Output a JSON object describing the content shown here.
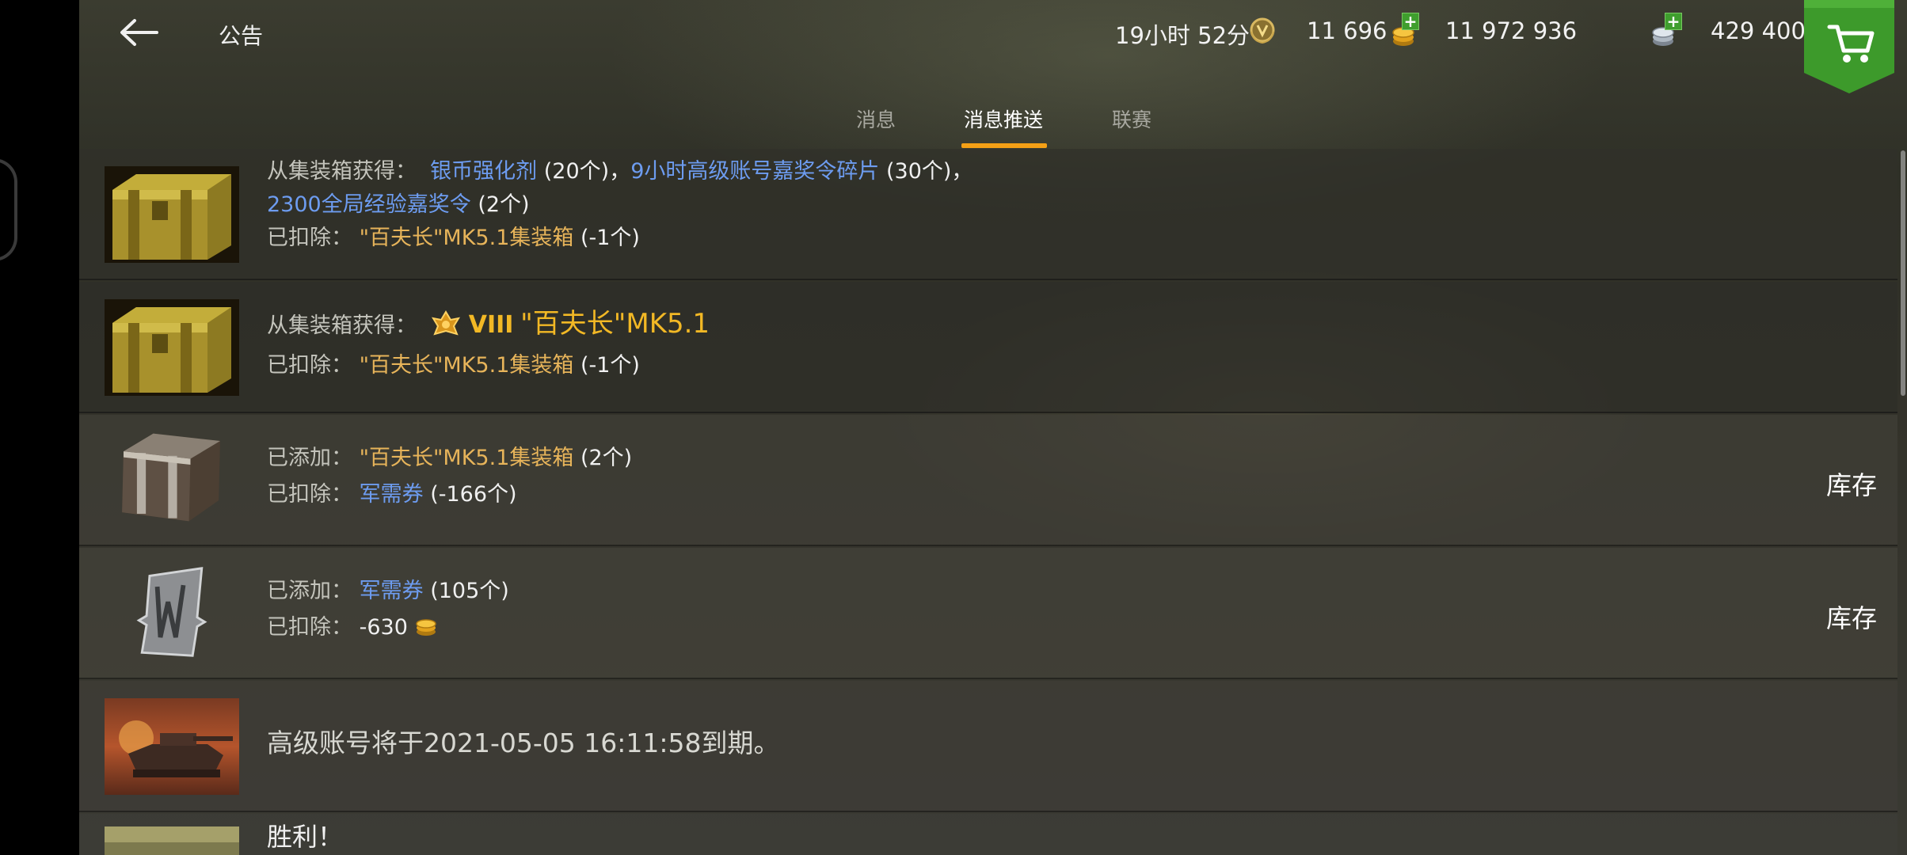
{
  "header": {
    "title": "公告",
    "timer": "19小时 52分",
    "gold": "11 696",
    "silver": "11 972 936",
    "xp": "429 400"
  },
  "tabs": [
    {
      "label": "消息",
      "active": false
    },
    {
      "label": "消息推送",
      "active": true
    },
    {
      "label": "联赛",
      "active": false
    }
  ],
  "messages": [
    {
      "icon": "golden-container-icon",
      "line1_label": "从集装箱获得：",
      "line1_item1": "银币强化剂",
      "line1_qty1": "(20个)",
      "line1_sep": "，",
      "line1_item2": "9小时高级账号嘉奖令碎片",
      "line1_qty2": "(30个)",
      "line1_end": "，",
      "line2_item": "2300全局经验嘉奖令",
      "line2_qty": "(2个)",
      "line3_label": "已扣除：",
      "line3_item": "\"百夫长\"MK5.1集装箱",
      "line3_qty": "(-1个)"
    },
    {
      "icon": "golden-container-icon",
      "line1_label": "从集装箱获得：",
      "tier": "VIII",
      "tank": "\"百夫长\"MK5.1",
      "line2_label": "已扣除：",
      "line2_item": "\"百夫长\"MK5.1集装箱",
      "line2_qty": "(-1个)"
    },
    {
      "icon": "steel-container-icon",
      "line1_label": "已添加：",
      "line1_item": "\"百夫长\"MK5.1集装箱",
      "line1_qty": "(2个)",
      "line2_label": "已扣除：",
      "line2_item": "军需券",
      "line2_qty": "(-166个)",
      "action": "库存"
    },
    {
      "icon": "supply-voucher-icon",
      "line1_label": "已添加：",
      "line1_item": "军需券",
      "line1_qty": "(105个)",
      "line2_label": "已扣除：",
      "line2_value": "-630",
      "action": "库存"
    },
    {
      "icon": "tank-battle-image",
      "text": "高级账号将于2021-05-05 16:11:58到期。"
    },
    {
      "icon": "battle-image",
      "text": "胜利！"
    }
  ],
  "colors": {
    "accent": "#f4a016",
    "link_blue": "#6d9cf0",
    "item_gold": "#e7b45a",
    "tank_gold": "#f2b825",
    "shop_green": "#3d9a2b"
  }
}
